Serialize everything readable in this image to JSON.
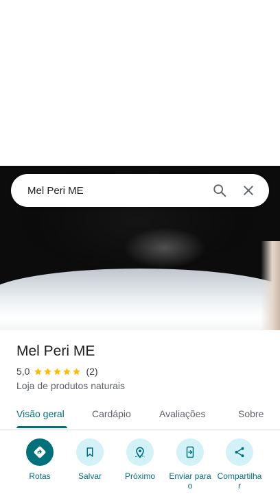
{
  "search": {
    "query": "Mel Peri ME"
  },
  "place": {
    "name": "Mel Peri ME",
    "rating": "5,0",
    "stars": 5,
    "review_count": "(2)",
    "category": "Loja de produtos naturais"
  },
  "tabs": [
    {
      "label": "Visão geral",
      "active": true
    },
    {
      "label": "Cardápio"
    },
    {
      "label": "Avaliações"
    },
    {
      "label": "Sobre"
    }
  ],
  "actions": [
    {
      "label": "Rotas",
      "icon": "directions-icon"
    },
    {
      "label": "Salvar",
      "icon": "bookmark-icon"
    },
    {
      "label": "Próximo",
      "icon": "nearby-icon"
    },
    {
      "label_lines": [
        "Enviar para",
        "o"
      ],
      "icon": "send-to-phone-icon"
    },
    {
      "label_lines": [
        "Compartilha",
        "r"
      ],
      "icon": "share-icon"
    }
  ],
  "colors": {
    "accent": "#00707a",
    "action_bg": "#d2f2f8",
    "star": "#fbbc04"
  }
}
